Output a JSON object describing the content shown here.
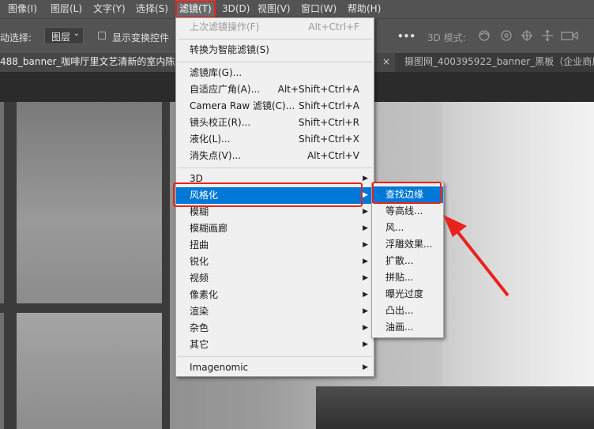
{
  "menubar": {
    "items": [
      {
        "label": "图像(I)"
      },
      {
        "label": "图层(L)"
      },
      {
        "label": "文字(Y)"
      },
      {
        "label": "选择(S)"
      },
      {
        "label": "滤镜(T)"
      },
      {
        "label": "3D(D)"
      },
      {
        "label": "视图(V)"
      },
      {
        "label": "窗口(W)"
      },
      {
        "label": "帮助(H)"
      }
    ]
  },
  "options": {
    "auto_select_label": "动选择:",
    "select_value": "图层",
    "show_transform_label": "显示变换控件",
    "more": "•••",
    "mode_3d_label": "3D 模式:"
  },
  "tabs": {
    "tab1": "488_banner_咖啡厅里文艺清新的室内陈",
    "tab2": "摄图网_400395922_banner_黑板（企业商用",
    "close": "×"
  },
  "filter_menu": {
    "items": [
      {
        "label": "上次滤镜操作(F)",
        "shortcut": "Alt+Ctrl+F",
        "disabled": true
      },
      {
        "label": "转换为智能滤镜(S)"
      },
      {
        "label": "滤镜库(G)..."
      },
      {
        "label": "自适应广角(A)...",
        "shortcut": "Alt+Shift+Ctrl+A"
      },
      {
        "label": "Camera Raw 滤镜(C)...",
        "shortcut": "Shift+Ctrl+A"
      },
      {
        "label": "镜头校正(R)...",
        "shortcut": "Shift+Ctrl+R"
      },
      {
        "label": "液化(L)...",
        "shortcut": "Shift+Ctrl+X"
      },
      {
        "label": "消失点(V)...",
        "shortcut": "Alt+Ctrl+V"
      },
      {
        "label": "3D"
      },
      {
        "label": "风格化",
        "highlighted": true
      },
      {
        "label": "模糊"
      },
      {
        "label": "模糊画廊"
      },
      {
        "label": "扭曲"
      },
      {
        "label": "锐化"
      },
      {
        "label": "视频"
      },
      {
        "label": "像素化"
      },
      {
        "label": "渲染"
      },
      {
        "label": "杂色"
      },
      {
        "label": "其它"
      },
      {
        "label": "Imagenomic"
      }
    ]
  },
  "stylize_submenu": {
    "items": [
      {
        "label": "查找边缘",
        "highlighted": true
      },
      {
        "label": "等高线..."
      },
      {
        "label": "风..."
      },
      {
        "label": "浮雕效果..."
      },
      {
        "label": "扩散..."
      },
      {
        "label": "拼贴..."
      },
      {
        "label": "曝光过度"
      },
      {
        "label": "凸出..."
      },
      {
        "label": "油画..."
      }
    ]
  },
  "colors": {
    "highlight": "#0078d7",
    "annotation_red": "#e8231c"
  }
}
